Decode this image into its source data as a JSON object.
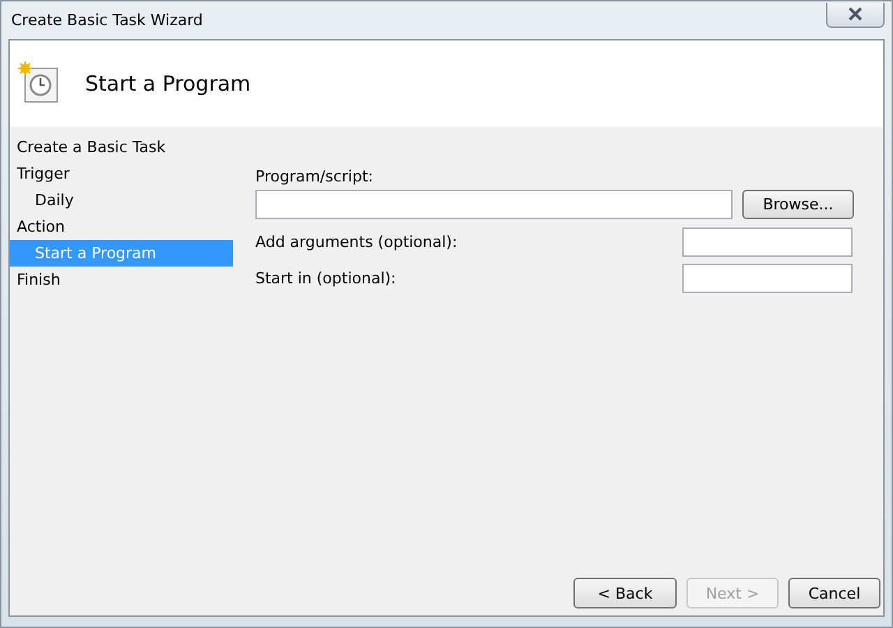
{
  "window": {
    "title": "Create Basic Task Wizard"
  },
  "header": {
    "title": "Start a Program"
  },
  "steps": [
    {
      "label": "Create a Basic Task",
      "selected": false
    },
    {
      "label": "Trigger",
      "selected": false,
      "children": [
        {
          "label": "Daily",
          "selected": false
        }
      ]
    },
    {
      "label": "Action",
      "selected": false,
      "children": [
        {
          "label": "Start a Program",
          "selected": true
        }
      ]
    },
    {
      "label": "Finish",
      "selected": false
    }
  ],
  "fields": [
    {
      "kind": "stacked",
      "label": "Program/script:",
      "button": "Browse..."
    },
    {
      "kind": "inline",
      "label": "Add arguments (optional):"
    },
    {
      "kind": "inline",
      "label": "Start in (optional):"
    }
  ],
  "buttons": [
    {
      "label": "< Back",
      "disabled": false
    },
    {
      "label": "Next >",
      "disabled": true
    },
    {
      "label": "Cancel",
      "disabled": false
    }
  ]
}
